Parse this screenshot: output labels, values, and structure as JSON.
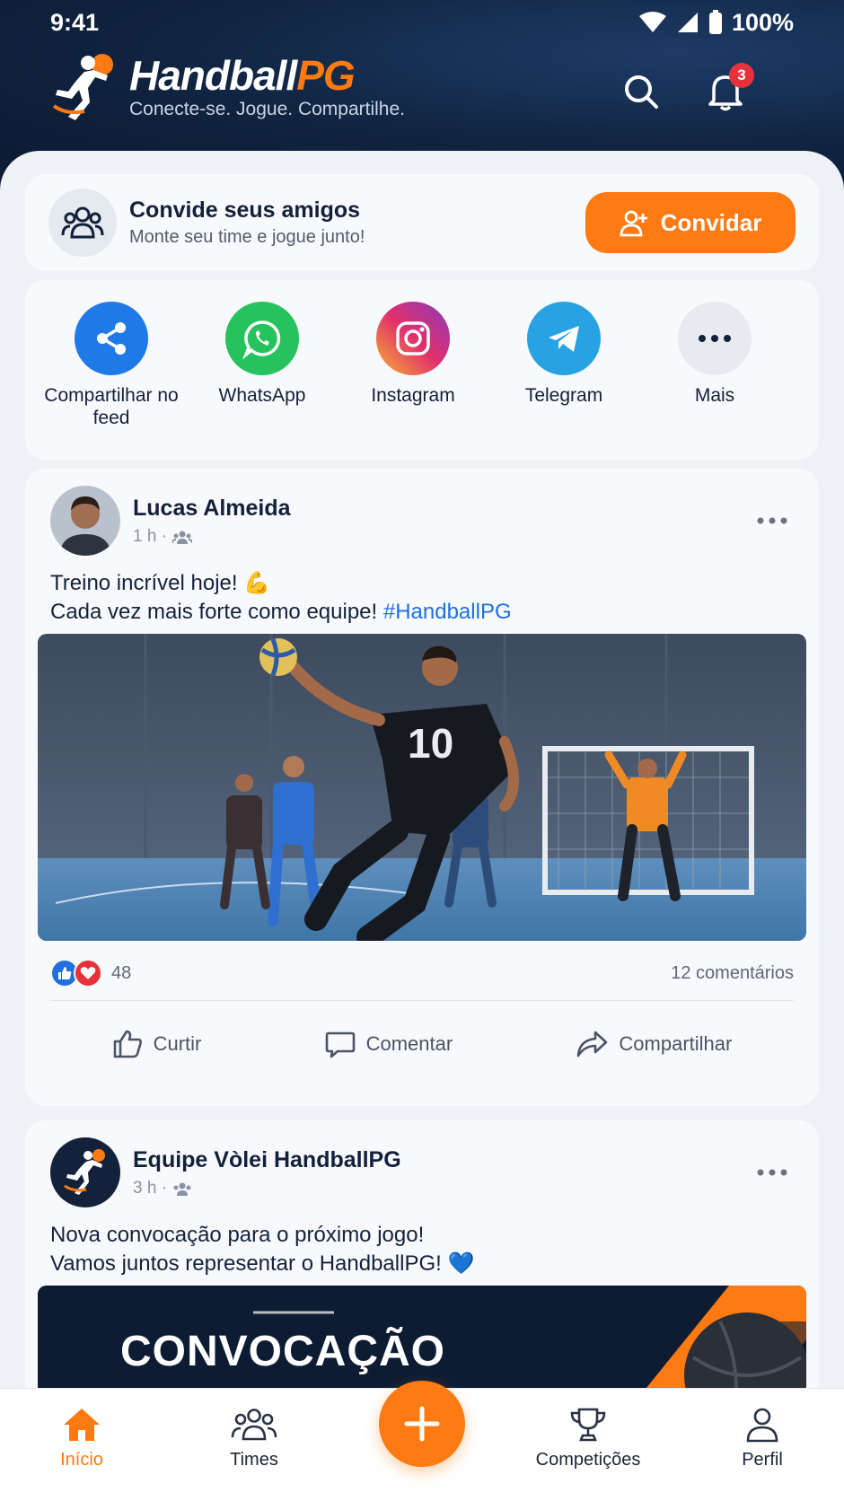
{
  "status_bar": {
    "time": "9:41",
    "battery": "100%"
  },
  "header": {
    "brand_main": "Handball",
    "brand_accent": "PG",
    "tagline": "Conecte-se. Jogue. Compartilhe.",
    "notification_count": "3"
  },
  "invite": {
    "title": "Convide seus amigos",
    "subtitle": "Monte seu time e jogue junto!",
    "button_label": "Convidar"
  },
  "share": {
    "items": [
      {
        "label": "Compartilhar no feed",
        "icon": "share-icon",
        "color": "#1f7ae8"
      },
      {
        "label": "WhatsApp",
        "icon": "whatsapp-icon",
        "color": "#25c25d"
      },
      {
        "label": "Instagram",
        "icon": "instagram-icon",
        "color": "#d6307a"
      },
      {
        "label": "Telegram",
        "icon": "telegram-icon",
        "color": "#27a3e3"
      },
      {
        "label": "Mais",
        "icon": "more-icon",
        "color": "#e7ebf1"
      }
    ]
  },
  "posts": [
    {
      "author": "Lucas Almeida",
      "time": "1 h ·",
      "text_line1": "Treino incrível hoje! 💪",
      "text_line2": "Cada vez mais forte como equipe! ",
      "hashtag": "#HandballPG",
      "jersey_number": "10",
      "reaction_count": "48",
      "comments": "12 comentários",
      "actions": {
        "like": "Curtir",
        "comment": "Comentar",
        "share": "Compartilhar"
      }
    },
    {
      "author": "Equipe Vòlei HandballPG",
      "time": "3 h ·",
      "text_line1": "Nova convocação para o próximo jogo!",
      "text_line2": "Vamos juntos representar o HandballPG! 💙",
      "banner_title": "CONVOCAÇÃO"
    }
  ],
  "bottom_nav": {
    "items": [
      {
        "label": "Início",
        "icon": "home-icon",
        "active": true
      },
      {
        "label": "Times",
        "icon": "team-icon",
        "active": false
      },
      {
        "label": "Competições",
        "icon": "trophy-icon",
        "active": false
      },
      {
        "label": "Perfil",
        "icon": "user-icon",
        "active": false
      }
    ]
  },
  "colors": {
    "accent": "#ff7a12",
    "header_bg": "#10233f",
    "link": "#1f6fe0"
  }
}
